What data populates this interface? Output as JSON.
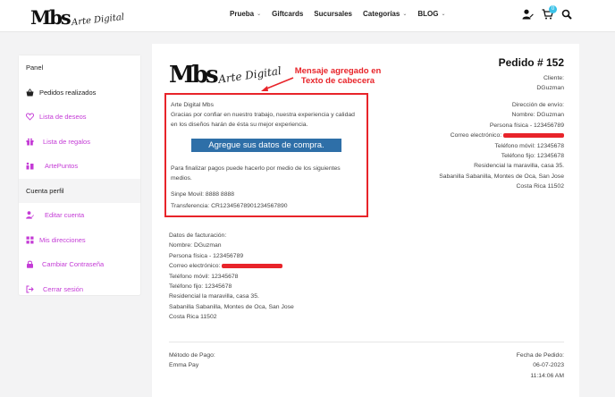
{
  "header": {
    "logo_main": "Mbs",
    "logo_script": "Arte Digital",
    "nav": [
      {
        "label": "Prueba",
        "has_dropdown": true
      },
      {
        "label": "Giftcards",
        "has_dropdown": false
      },
      {
        "label": "Sucursales",
        "has_dropdown": false
      },
      {
        "label": "Categorías",
        "has_dropdown": true
      },
      {
        "label": "BLOG",
        "has_dropdown": true
      }
    ],
    "icons": [
      "user-edit-icon",
      "cart-icon",
      "search-icon"
    ],
    "cart_count": "0",
    "accent": "#3bc2e8"
  },
  "sidebar": {
    "panel_heading": "Panel",
    "items": [
      {
        "label": "Pedidos realizados",
        "icon": "basket-icon"
      },
      {
        "label": "Lista de deseos",
        "icon": "heart-icon"
      },
      {
        "label": "Lista de regalos",
        "icon": "gift-icon"
      },
      {
        "label": "ArtePuntos",
        "icon": "points-icon"
      }
    ],
    "account_heading": "Cuenta perfil",
    "account_items": [
      {
        "label": "Editar cuenta",
        "icon": "user-edit-icon"
      },
      {
        "label": "Mis direcciones",
        "icon": "grid-icon"
      },
      {
        "label": "Cambiar Contraseña",
        "icon": "lock-icon"
      },
      {
        "label": "Cerrar sesión",
        "icon": "logout-icon"
      }
    ],
    "link_color": "#c43bd6"
  },
  "order": {
    "logo_main": "Mbs",
    "logo_script": "Arte Digital",
    "annotation": "Mensaje agregado en Texto de cabecera",
    "title": "Pedido # 152",
    "client_label": "Cliente:",
    "client_name": "DGuzman",
    "header_message": {
      "company": "Arte Digital Mbs",
      "thanks_line1": "Gracias por confiar en nuestro trabajo, nuestra experiencia y calidad",
      "thanks_line2": "en los diseños harán de ésta su mejor experiencia.",
      "cta": "Agregue sus datos de compra.",
      "pay_line1": "Para finalizar pagos puede hacerlo por medio de los siguientes",
      "pay_line2": "medios.",
      "sinpe": "Sinpe Movil: 8888 8888",
      "transfer": "Transferencia: CR12345678901234567890"
    },
    "shipping": {
      "heading": "Dirección de envío:",
      "name": "Nombre: DGuzman",
      "id": "Persona física - 123456789",
      "email_label": "Correo electrónico:",
      "mobile": "Teléfono móvil: 12345678",
      "phone": "Teléfono fijo: 12345678",
      "address1": "Residencial la maravilla, casa 35.",
      "address2": "Sabanilla Sabanilla, Montes de Oca, San Jose",
      "address3": "Costa Rica 11502"
    },
    "billing": {
      "heading": "Datos de facturación:",
      "name": "Nombre: DGuzman",
      "id": "Persona física - 123456789",
      "email_label": "Correo electrónico:",
      "mobile": "Teléfono móvil: 12345678",
      "phone": "Teléfono fijo: 12345678",
      "address1": "Residencial la maravilla, casa 35.",
      "address2": "Sabanilla Sabanilla, Montes de Oca, San Jose",
      "address3": "Costa Rica 11502"
    },
    "payment_label": "Método de Pago:",
    "payment_value": "Emma Pay",
    "date_label": "Fecha de Pedido:",
    "date_value": "06-07-2023",
    "time_value": "11:14:06 AM",
    "highlight_color": "#e8242a",
    "cta_color": "#2e6fa8"
  }
}
